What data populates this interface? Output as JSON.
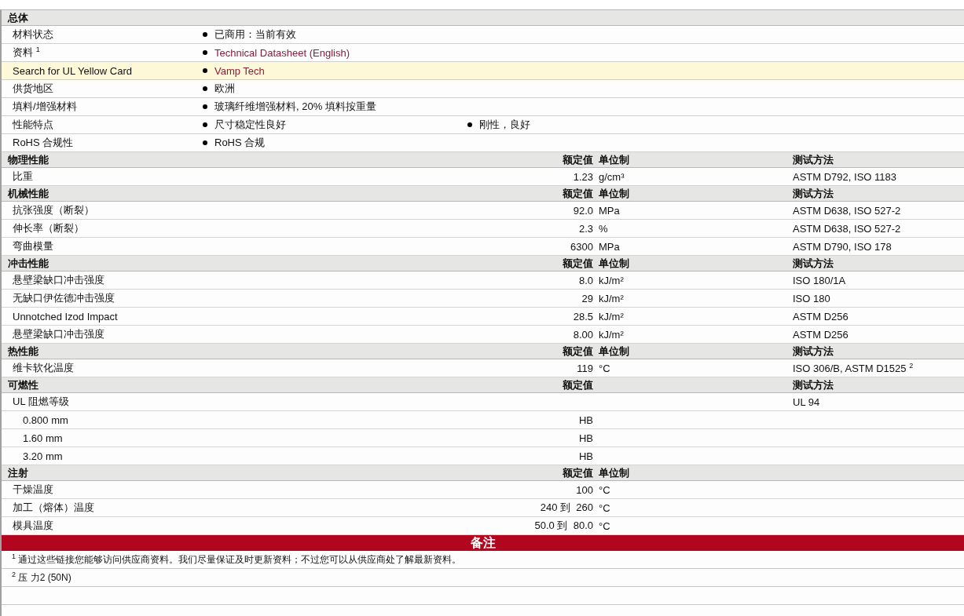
{
  "general": {
    "title": "总体",
    "rows": [
      {
        "label": "材料状态",
        "highlighted": false,
        "items": [
          {
            "text": "已商用：当前有效",
            "link": false
          }
        ]
      },
      {
        "label": "资料 $^{1}$",
        "highlighted": false,
        "items": [
          {
            "text": "Technical Datasheet (English)",
            "link": true
          }
        ]
      },
      {
        "label": "Search for UL Yellow Card",
        "highlighted": true,
        "items": [
          {
            "text": "Vamp Tech",
            "link": true
          }
        ]
      },
      {
        "label": "供货地区",
        "highlighted": false,
        "items": [
          {
            "text": "欧洲",
            "link": false
          }
        ]
      },
      {
        "label": "填料/增强材料",
        "highlighted": false,
        "items": [
          {
            "text": "玻璃纤维增强材料, 20% 填料按重量",
            "link": false
          }
        ]
      },
      {
        "label": "性能特点",
        "highlighted": false,
        "items": [
          {
            "text": "尺寸稳定性良好",
            "link": false
          },
          {
            "text": "刚性，良好",
            "link": false
          }
        ]
      },
      {
        "label": "RoHS 合规性",
        "highlighted": false,
        "items": [
          {
            "text": "RoHS 合规",
            "link": false
          }
        ]
      }
    ]
  },
  "sections": [
    {
      "title": "物理性能",
      "value_heading": "额定值",
      "unit_heading": "单位制",
      "method_heading": "测试方法",
      "rows": [
        {
          "label": "比重",
          "value": "1.23",
          "unit": "g/cm³",
          "method": "ASTM D792, ISO 1183"
        }
      ]
    },
    {
      "title": "机械性能",
      "value_heading": "额定值",
      "unit_heading": "单位制",
      "method_heading": "测试方法",
      "rows": [
        {
          "label": "抗张强度（断裂）",
          "value": "92.0",
          "unit": "MPa",
          "method": "ASTM D638, ISO 527-2"
        },
        {
          "label": "伸长率（断裂）",
          "value": "2.3",
          "unit": "%",
          "method": "ASTM D638, ISO 527-2"
        },
        {
          "label": "弯曲模量",
          "value": "6300",
          "unit": "MPa",
          "method": "ASTM D790, ISO 178"
        }
      ]
    },
    {
      "title": "冲击性能",
      "value_heading": "额定值",
      "unit_heading": "单位制",
      "method_heading": "测试方法",
      "rows": [
        {
          "label": "悬壁梁缺口冲击强度",
          "value": "8.0",
          "unit": "kJ/m²",
          "method": "ISO 180/1A"
        },
        {
          "label": "无缺口伊佐德冲击强度",
          "value": "29",
          "unit": "kJ/m²",
          "method": "ISO 180"
        },
        {
          "label": "Unnotched Izod Impact",
          "value": "28.5",
          "unit": "kJ/m²",
          "method": "ASTM D256"
        },
        {
          "label": "悬壁梁缺口冲击强度",
          "value": "8.00",
          "unit": "kJ/m²",
          "method": "ASTM D256"
        }
      ]
    },
    {
      "title": "热性能",
      "value_heading": "额定值",
      "unit_heading": "单位制",
      "method_heading": "测试方法",
      "rows": [
        {
          "label": "维卡软化温度",
          "value": "119",
          "unit": "°C",
          "method": "ISO 306/B, ASTM D1525 $^{2}$"
        }
      ]
    },
    {
      "title": "可燃性",
      "value_heading": "额定值",
      "method_heading": "测试方法",
      "rows": [
        {
          "label": "UL 阻燃等级",
          "method": "UL 94",
          "children": [
            {
              "label": "0.800 mm",
              "value": "HB"
            },
            {
              "label": "1.60 mm",
              "value": "HB"
            },
            {
              "label": "3.20 mm",
              "value": "HB"
            }
          ]
        }
      ]
    },
    {
      "title": "注射",
      "value_heading": "额定值",
      "unit_heading": "单位制",
      "rows": [
        {
          "label": "干燥温度",
          "value": "100",
          "unit": "°C"
        },
        {
          "label": "加工（熔体）温度",
          "value": "240 到  260",
          "unit": "°C"
        },
        {
          "label": "模具温度",
          "value": "50.0 到  80.0",
          "unit": "°C"
        }
      ]
    }
  ],
  "notes": {
    "title": "备注",
    "items": [
      "$^{1}$ 通过这些链接您能够访问供应商资料。我们尽量保证及时更新资料；不过您可以从供应商处了解最新资料。",
      "$^{2}$ 压  力2 (50N)"
    ]
  }
}
